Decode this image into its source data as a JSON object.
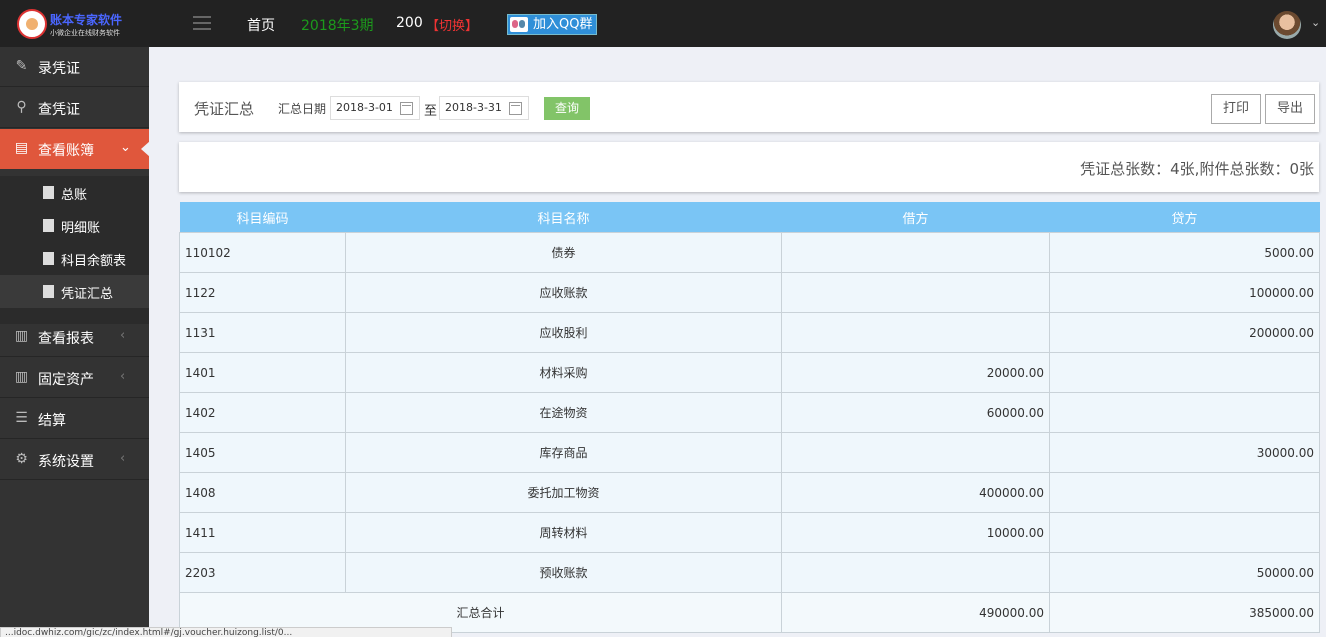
{
  "topbar": {
    "logo_title": "账本专家软件",
    "logo_subtitle": "小微企业在线财务软件",
    "nav_home": "首页",
    "period": "2018年3期",
    "account_number": "200",
    "switch_label": "【切换】",
    "qq_button": "加入QQ群"
  },
  "sidebar": {
    "items": [
      {
        "label": "录凭证",
        "icon": "edit-icon"
      },
      {
        "label": "查凭证",
        "icon": "search-icon"
      },
      {
        "label": "查看账簿",
        "icon": "book-icon"
      },
      {
        "label": "查看报表",
        "icon": "bar-chart-icon"
      },
      {
        "label": "固定资产",
        "icon": "bar-chart-icon"
      },
      {
        "label": "结算",
        "icon": "list-icon"
      },
      {
        "label": "系统设置",
        "icon": "gear-icon"
      }
    ],
    "subitems": [
      {
        "label": "总账",
        "icon": "yen-icon"
      },
      {
        "label": "明细账",
        "icon": "document-icon"
      },
      {
        "label": "科目余额表",
        "icon": "table-icon"
      },
      {
        "label": "凭证汇总",
        "icon": "list-icon"
      }
    ]
  },
  "header": {
    "title": "凭证汇总",
    "date_label": "汇总日期",
    "start_date": "2018-3-01",
    "to_label": "至",
    "end_date": "2018-3-31",
    "query_button": "查询",
    "print_button": "打印",
    "export_button": "导出"
  },
  "summary": {
    "text": "凭证总张数：4张,附件总张数：0张"
  },
  "table": {
    "columns": [
      "科目编码",
      "科目名称",
      "借方",
      "贷方"
    ],
    "rows": [
      {
        "code": "110102",
        "name": "债券",
        "debit": "",
        "credit": "5000.00"
      },
      {
        "code": "1122",
        "name": "应收账款",
        "debit": "",
        "credit": "100000.00"
      },
      {
        "code": "1131",
        "name": "应收股利",
        "debit": "",
        "credit": "200000.00"
      },
      {
        "code": "1401",
        "name": "材料采购",
        "debit": "20000.00",
        "credit": ""
      },
      {
        "code": "1402",
        "name": "在途物资",
        "debit": "60000.00",
        "credit": ""
      },
      {
        "code": "1405",
        "name": "库存商品",
        "debit": "",
        "credit": "30000.00"
      },
      {
        "code": "1408",
        "name": "委托加工物资",
        "debit": "400000.00",
        "credit": ""
      },
      {
        "code": "1411",
        "name": "周转材料",
        "debit": "10000.00",
        "credit": ""
      },
      {
        "code": "2203",
        "name": "预收账款",
        "debit": "",
        "credit": "50000.00"
      }
    ],
    "total": {
      "label": "汇总合计",
      "debit": "490000.00",
      "credit": "385000.00"
    }
  },
  "statusbar": {
    "text": "...idoc.dwhiz.com/gic/zc/index.html#/gj.voucher.huizong.list/0..."
  },
  "colors": {
    "accent": "#e0573c",
    "header_bar": "#222222",
    "sidebar": "#333333",
    "table_header": "#7ac5f5",
    "query_button": "#82c468",
    "period_green": "#1c9a1c"
  }
}
